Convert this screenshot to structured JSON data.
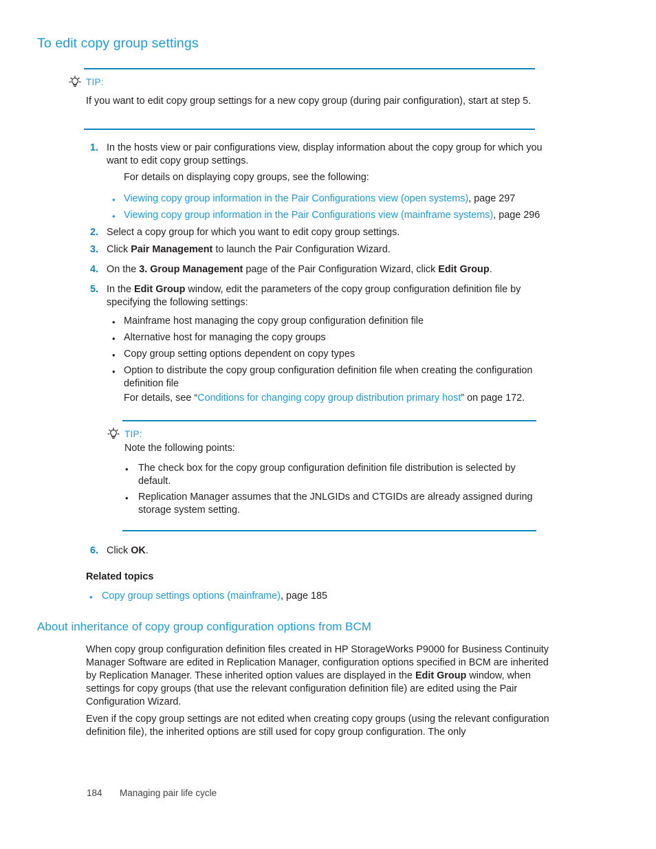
{
  "page": {
    "heading_1": "To edit copy group settings",
    "heading_2": "About inheritance of copy group configuration options from BCM"
  },
  "tip1": {
    "icon": "lightbulb-icon",
    "label": "TIP:",
    "text": "If you want to edit copy group settings for a new copy group (during pair configuration), start at step 5."
  },
  "steps": [
    {
      "number": "1.",
      "text": "In the hosts view or pair configurations view, display information about the copy group for which you want to edit copy group settings.",
      "sub_paragraph": "For details on displaying copy groups, see the following:",
      "links": [
        {
          "bullet": "•",
          "link": "Viewing copy group information in the Pair Configurations view (open systems)",
          "suffix": ", page 297"
        },
        {
          "bullet": "•",
          "link": "Viewing copy group information in the Pair Configurations view (mainframe systems)",
          "suffix": ", page 296"
        }
      ]
    },
    {
      "number": "2.",
      "text": "Select a copy group for which you want to edit copy group settings."
    },
    {
      "number": "3.",
      "prefix": "Click ",
      "bold": "Pair Management",
      "suffix": " to launch the Pair Configuration Wizard."
    },
    {
      "number": "4.",
      "prefix": "On the ",
      "bold": "3. Group Management",
      "middle": " page of the Pair Configuration Wizard, click ",
      "bold2": "Edit Group",
      "suffix": "."
    },
    {
      "number": "5.",
      "prefix": "In the ",
      "bold": "Edit Group",
      "suffix": " window, edit the parameters of the copy group configuration definition file by specifying the following settings:"
    },
    {
      "number": "6.",
      "prefix": "Click ",
      "bold": "OK",
      "suffix": "."
    }
  ],
  "step5_bullets": [
    {
      "bullet": "•",
      "text": "Mainframe host managing the copy group configuration definition file"
    },
    {
      "bullet": "•",
      "text": "Alternative host for managing the copy groups"
    },
    {
      "bullet": "•",
      "text": "Copy group setting options dependent on copy types"
    },
    {
      "bullet": "•",
      "text": "Option to distribute the copy group configuration definition file when creating the configuration definition file"
    }
  ],
  "step5_detail": {
    "prefix": "For details, see “",
    "link": "Conditions for changing copy group distribution primary host",
    "suffix": "” on page 172."
  },
  "tip2": {
    "icon": "lightbulb-icon",
    "label": "TIP:",
    "intro": "Note the following points:",
    "bullets": [
      {
        "bullet": "•",
        "text": "The check box for the copy group configuration definition file distribution is selected by default."
      },
      {
        "bullet": "•",
        "text": "Replication Manager assumes that the JNLGIDs and CTGIDs are already assigned during storage system setting."
      }
    ]
  },
  "related": {
    "title": "Related topics",
    "items": [
      {
        "bullet": "•",
        "link": "Copy group settings options (mainframe)",
        "suffix": ", page 185"
      }
    ]
  },
  "section2": {
    "paragraph1_a": "When copy group configuration definition files created in HP StorageWorks P9000 for Business Continuity Manager Software are edited in Replication Manager, configuration options specified in BCM are inherited by Replication Manager. These inherited option values are displayed in the ",
    "paragraph1_bold1": "Edit Group",
    "paragraph1_b": " window, when settings for copy groups (that use the relevant configuration definition file) are edited using the Pair Configuration Wizard.",
    "paragraph2": "Even if the copy group settings are not edited when creating copy groups (using the relevant configuration definition file), the inherited options are still used for copy group configuration. The only"
  },
  "footer": {
    "page_number": "184",
    "chapter": "Managing pair life cycle"
  },
  "colors": {
    "accent": "#1b9dd9",
    "rule": "#0e86c0",
    "text": "#231f20"
  }
}
